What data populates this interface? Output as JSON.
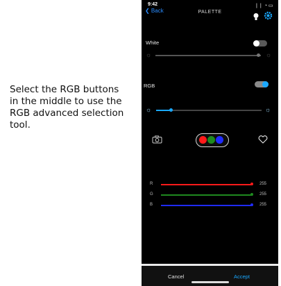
{
  "instruction": "Select the RGB buttons in the middle to use the RGB advanced selection tool.",
  "status": {
    "time": "9:42",
    "signal": "❘❘",
    "wifi": "◔",
    "battery": "▭"
  },
  "header": {
    "back_label": "❮ Back",
    "title": "PALETTE",
    "bulb_icon": "lightbulb-icon",
    "gear_icon": "gear-icon"
  },
  "white": {
    "label": "White",
    "enabled": false
  },
  "rgb": {
    "label": "RGB",
    "enabled": true
  },
  "colors": {
    "accent": "#1aa8ff",
    "red": "#ff1a1a",
    "green": "#1f8a1f",
    "blue": "#1f2bff",
    "background": "#000000"
  },
  "channels": [
    {
      "letter": "R",
      "value": "255"
    },
    {
      "letter": "G",
      "value": "255"
    },
    {
      "letter": "B",
      "value": "255"
    }
  ],
  "footer": {
    "cancel_label": "Cancel",
    "accept_label": "Accept"
  }
}
